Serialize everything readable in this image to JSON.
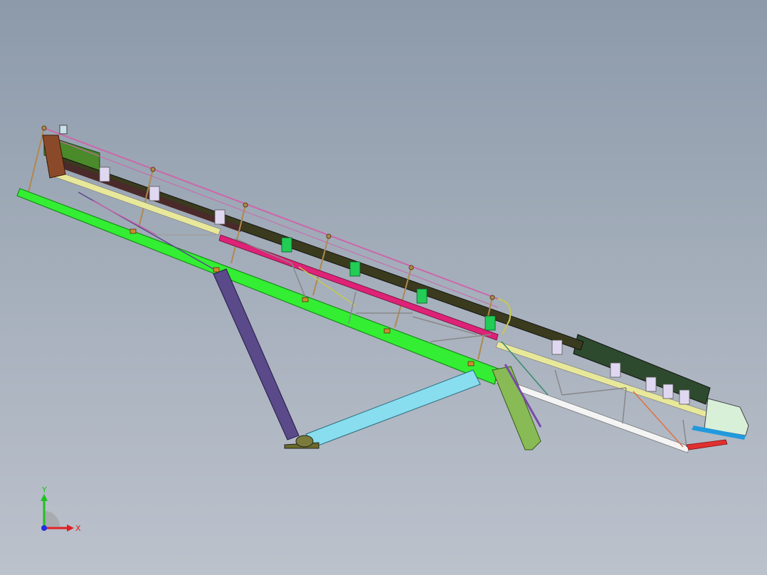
{
  "viewport": {
    "background_top": "#8c9aaa",
    "background_bottom": "#bcc2cc"
  },
  "model": {
    "colors": {
      "main_frame": "#33ee33",
      "main_frame_edge": "#1a8a1a",
      "belt": "#3a3a1e",
      "belt_upper": "#4a2a2a",
      "handrail": "#cc66aa",
      "post": "#b08850",
      "magenta_member": "#dd2277",
      "yellow_member": "#e8e89a",
      "purple_leg": "#5a4a8a",
      "cyan_strut": "#88ddee",
      "idler": "#e0d8f0",
      "green_idler": "#22cc55",
      "head_pulley": "#8a4a2a",
      "motor": "#4a8a2a",
      "light_green_bracket": "#88bb55",
      "white_frame": "#f4f4f4",
      "orange_brace": "#e07040",
      "red_brace": "#e03030",
      "hopper": "#d8f0d8",
      "hopper_stripe": "#2299dd",
      "dark_green_cover": "#2e4a2e"
    }
  },
  "triad": {
    "x_label": "X",
    "y_label": "Y",
    "x_color": "#e02020",
    "y_color": "#20c020",
    "z_color": "#2030e0"
  }
}
